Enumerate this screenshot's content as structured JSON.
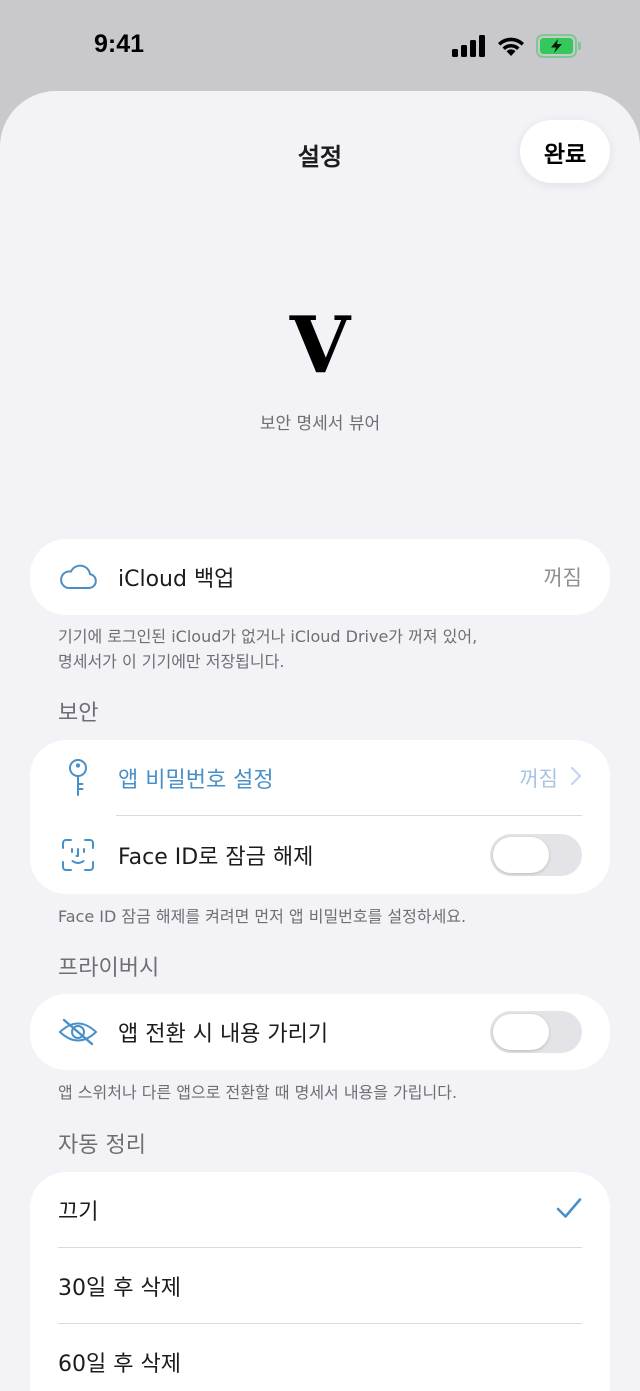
{
  "status_bar": {
    "time": "9:41"
  },
  "nav": {
    "title": "설정",
    "done_label": "완료"
  },
  "app": {
    "logo_letter": "V",
    "subtitle": "보안 명세서 뷰어"
  },
  "icloud": {
    "label": "iCloud 백업",
    "value": "꺼짐",
    "footnote_line1": "기기에 로그인된 iCloud가 없거나 iCloud Drive가 꺼져 있어,",
    "footnote_line2": "명세서가 이 기기에만 저장됩니다."
  },
  "security": {
    "header": "보안",
    "passcode_label": "앱 비밀번호 설정",
    "passcode_value": "꺼짐",
    "faceid_label": "Face ID로 잠금 해제",
    "faceid_on": false,
    "footnote": "Face ID 잠금 해제를 켜려면 먼저 앱 비밀번호를 설정하세요."
  },
  "privacy": {
    "header": "프라이버시",
    "hide_label": "앱 전환 시 내용 가리기",
    "hide_on": false,
    "footnote": "앱 스위처나 다른 앱으로 전환할 때 명세서 내용을 가립니다."
  },
  "auto_cleanup": {
    "header": "자동 정리",
    "options": [
      {
        "label": "끄기",
        "selected": true
      },
      {
        "label": "30일 후 삭제",
        "selected": false
      },
      {
        "label": "60일 후 삭제",
        "selected": false
      }
    ]
  },
  "colors": {
    "accent": "#4a90c8",
    "background": "#f2f2f7",
    "card": "#ffffff",
    "battery": "#34c759"
  },
  "icons": [
    "cellular-signal-icon",
    "wifi-icon",
    "battery-charging-icon",
    "cloud-icon",
    "key-icon",
    "face-id-icon",
    "eye-slash-icon",
    "chevron-right-icon",
    "checkmark-icon"
  ]
}
